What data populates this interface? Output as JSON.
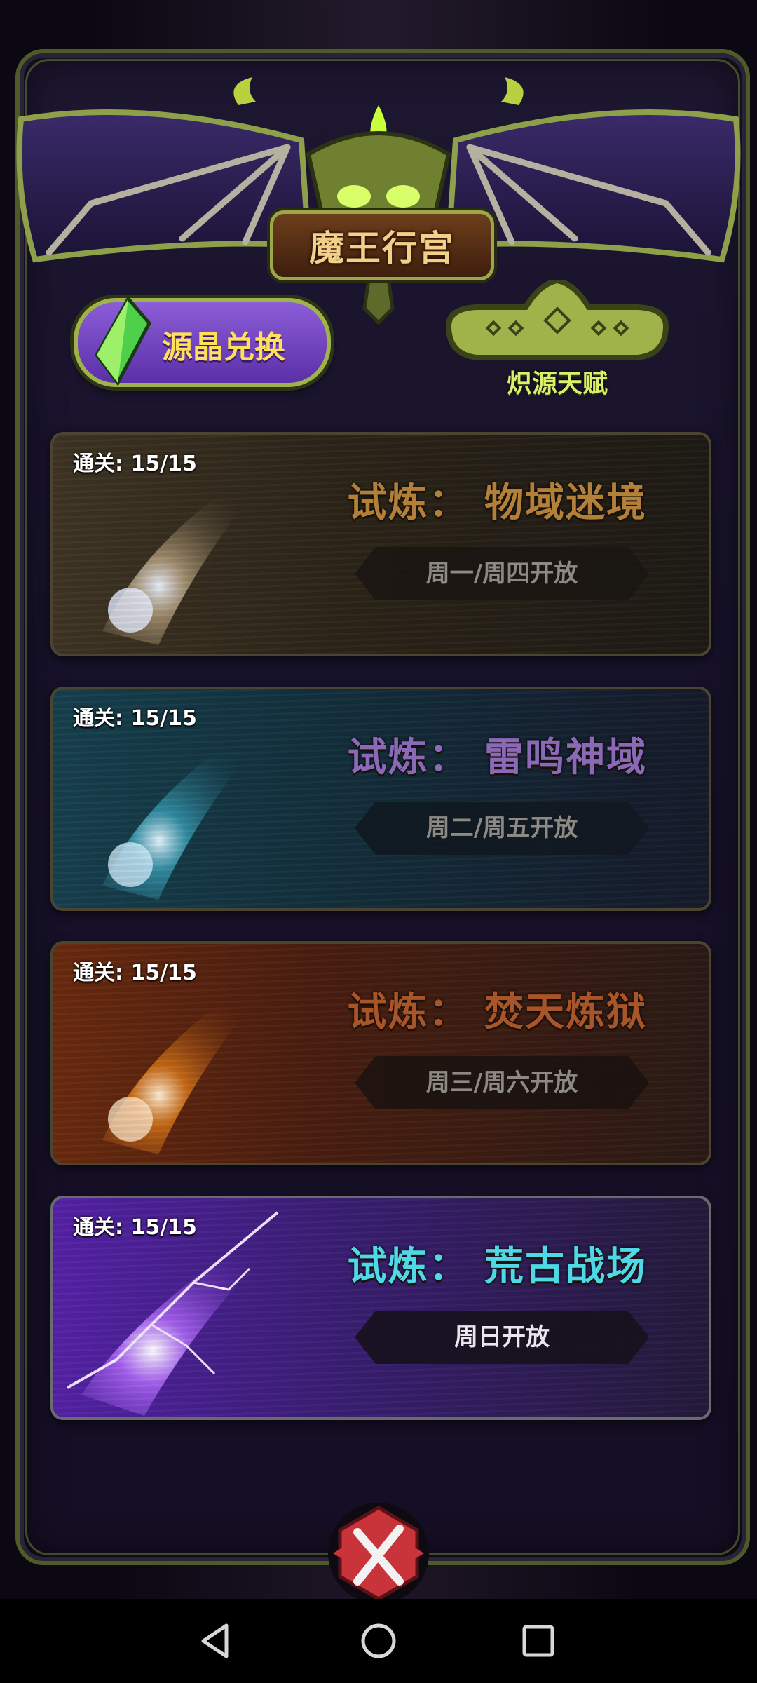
{
  "header": {
    "title": "魔王行宫"
  },
  "actions": {
    "crystal_exchange_label": "源晶兑换",
    "talent_label": "炽源天赋"
  },
  "trials": [
    {
      "clear": "通关: 15/15",
      "title": "试炼：  物域迷境",
      "schedule": "周一/周四开放"
    },
    {
      "clear": "通关: 15/15",
      "title": "试炼：  雷鸣神域",
      "schedule": "周二/周五开放"
    },
    {
      "clear": "通关: 15/15",
      "title": "试炼：  焚天炼狱",
      "schedule": "周三/周六开放"
    },
    {
      "clear": "通关: 15/15",
      "title": "试炼：  荒古战场",
      "schedule": "周日开放"
    }
  ],
  "colors": {
    "frame_border": "#4e5a2a",
    "card1_title": "#b3803a",
    "card2_title": "#8a6ab7",
    "card3_title": "#a8552a",
    "card4_title": "#4fd8e6",
    "button_text": "#ffe05a",
    "talent_text": "#d9f06a"
  },
  "icons": {
    "close": "close-x-icon",
    "crystal": "green-crystal-icon",
    "nav_back": "triangle-back-icon",
    "nav_home": "circle-home-icon",
    "nav_recents": "square-recents-icon"
  }
}
